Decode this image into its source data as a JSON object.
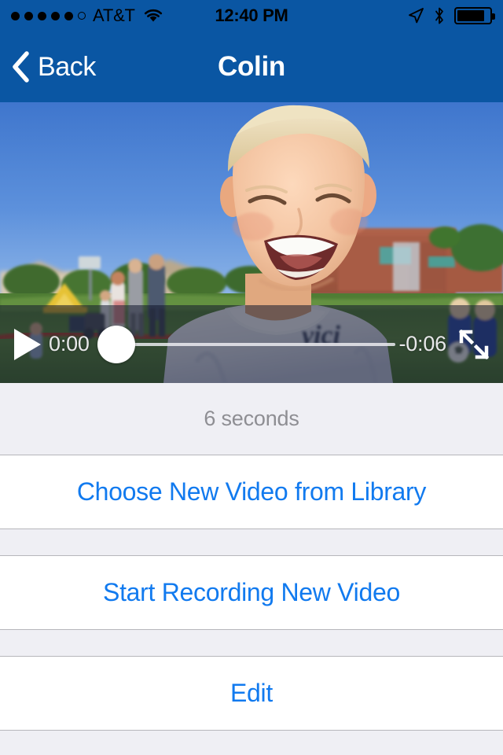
{
  "status_bar": {
    "carrier": "AT&T",
    "signal_dots_filled": 5,
    "signal_dots_total": 6,
    "wifi_icon": "wifi-icon",
    "time": "12:40 PM",
    "location_icon": "location-arrow-icon",
    "bluetooth_icon": "bluetooth-icon",
    "battery_icon": "battery-icon",
    "battery_level_percent": 85,
    "tint_color": "#000000",
    "background_color": "#0a56a3"
  },
  "nav_bar": {
    "back_label": "Back",
    "back_icon": "chevron-left-icon",
    "title": "Colin",
    "background_color": "#0a56a3",
    "text_color": "#ffffff"
  },
  "video_player": {
    "play_icon": "play-icon",
    "elapsed_time": "0:00",
    "remaining_time": "-0:06",
    "progress_percent": 0,
    "fullscreen_icon": "fullscreen-expand-icon",
    "overlay_color": "rgba(18,24,45,0.55)"
  },
  "table": {
    "section_header": "6 seconds",
    "rows": [
      {
        "label": "Choose New Video from Library",
        "name": "choose-new-video-from-library"
      },
      {
        "label": "Start Recording New Video",
        "name": "start-recording-new-video"
      },
      {
        "label": "Edit",
        "name": "edit"
      }
    ],
    "link_color": "#117aef",
    "background_color": "#efeff4",
    "separator_color": "#b6b6bb"
  }
}
